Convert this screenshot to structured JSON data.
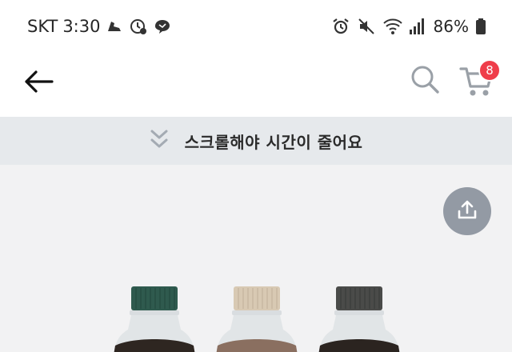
{
  "status_bar": {
    "carrier": "SKT",
    "time": "3:30",
    "battery": "86%",
    "left_icons": [
      "sports-shoe-icon",
      "clock-badge-icon",
      "chat-bubble-icon"
    ],
    "right_icons": [
      "alarm-icon",
      "mute-icon",
      "wifi-icon",
      "signal-icon",
      "battery-icon"
    ]
  },
  "header": {
    "back_icon": "arrow-left-icon",
    "search_icon": "search-icon",
    "cart_icon": "cart-icon",
    "cart_count": "8",
    "badge_color": "#ef3d4a"
  },
  "banner": {
    "icon": "double-chevron-down-icon",
    "text": "스크롤해야 시간이 줄어요"
  },
  "product": {
    "share_icon": "share-icon",
    "bottle_cap_colors": [
      "#2f5a4e",
      "#d8c9b3",
      "#4a4b49"
    ]
  }
}
